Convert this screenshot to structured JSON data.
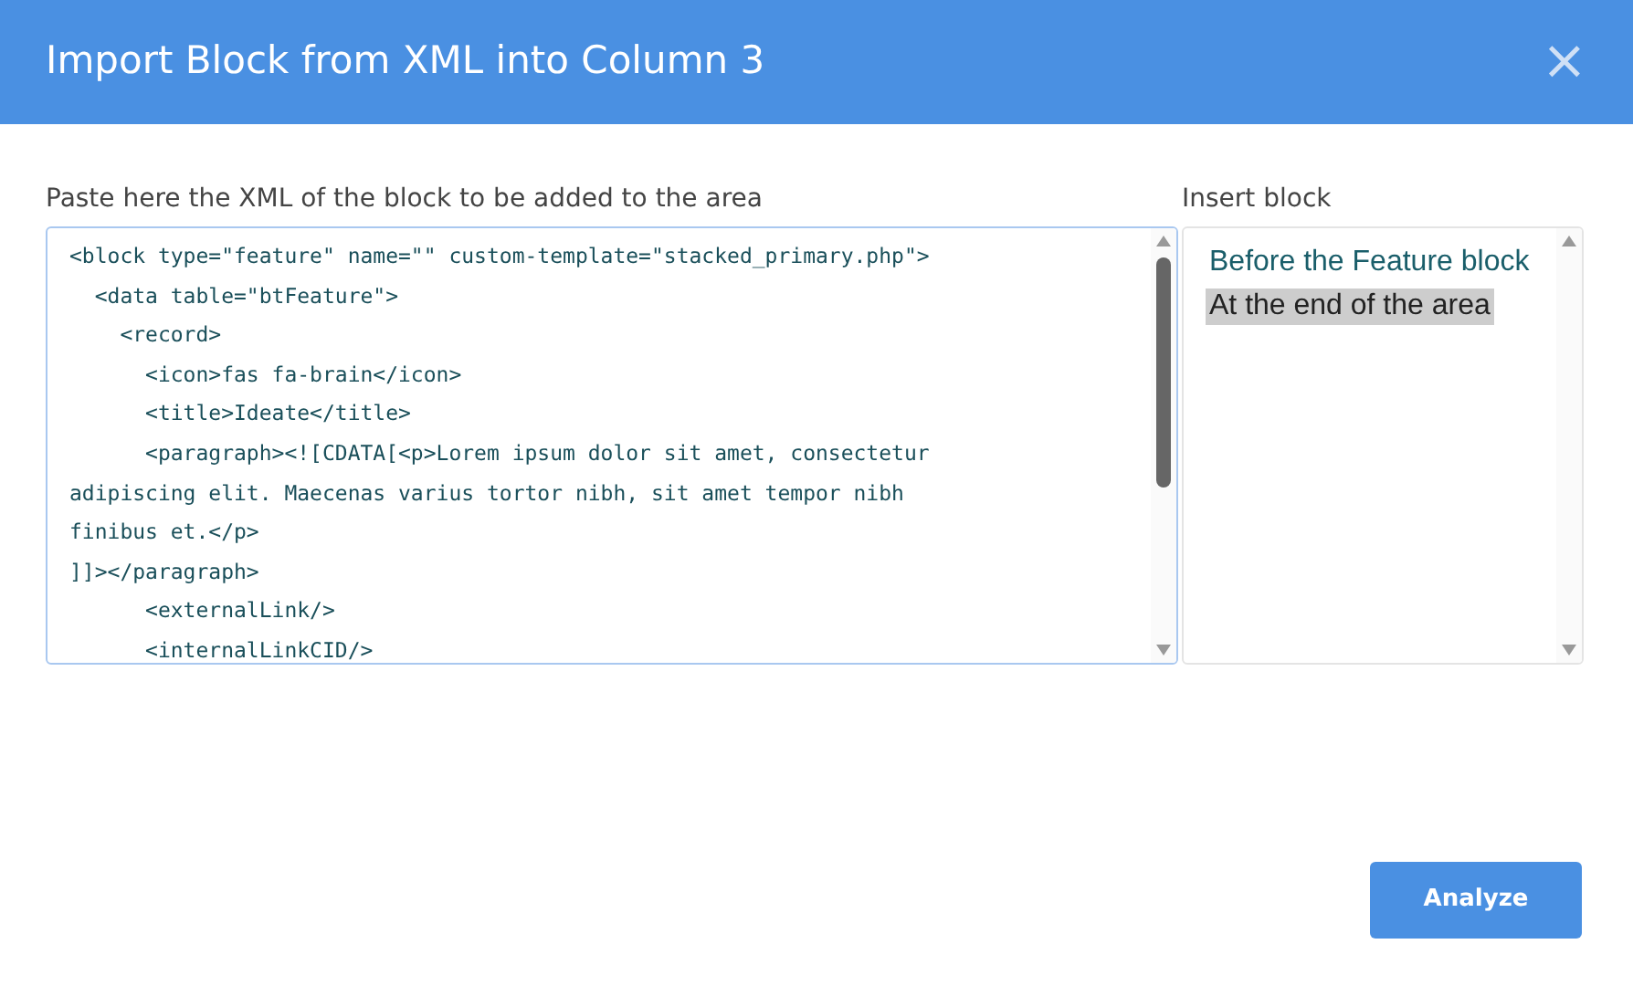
{
  "dialog": {
    "title": "Import Block from XML into Column 3",
    "close": "×"
  },
  "xml_field": {
    "label": "Paste here the XML of the block to be added to the area",
    "lines": [
      "<block type=\"feature\" name=\"\" custom-template=\"stacked_primary.php\">",
      "  <data table=\"btFeature\">",
      "    <record>",
      "      <icon>fas fa-brain</icon>",
      "      <title>Ideate</title>",
      "      <paragraph><![CDATA[<p>Lorem ipsum dolor sit amet, consectetur",
      "adipiscing elit. Maecenas varius tortor nibh, sit amet tempor nibh",
      "finibus et.</p>",
      "]]></paragraph>",
      "      <externalLink/>",
      "      <internalLinkCID/>"
    ]
  },
  "insert_block": {
    "label": "Insert block",
    "options": [
      {
        "label": "Before the Feature block",
        "selected": false
      },
      {
        "label": "At the end of the area",
        "selected": true
      }
    ]
  },
  "buttons": [
    "Analyze"
  ]
}
